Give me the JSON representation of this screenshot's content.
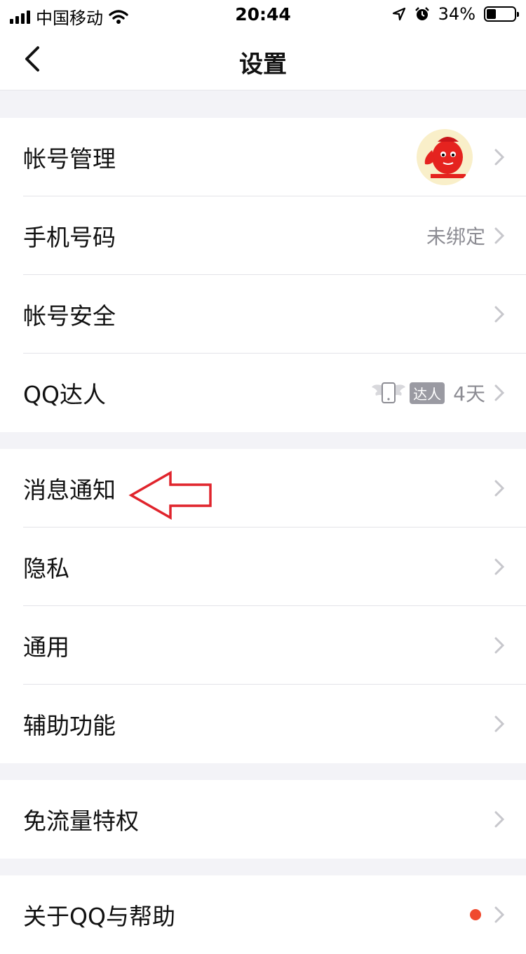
{
  "status_bar": {
    "carrier": "中国移动",
    "time": "20:44",
    "battery": "34%",
    "battery_level": 0.34
  },
  "nav": {
    "title": "设置",
    "back_icon": "chevron-left-icon"
  },
  "groups": [
    {
      "rows": [
        {
          "label": "帐号管理",
          "value": "",
          "extra": "avatar"
        },
        {
          "label": "手机号码",
          "value": "未绑定"
        },
        {
          "label": "帐号安全",
          "value": ""
        },
        {
          "label": "QQ达人",
          "badge": "达人",
          "value": "4天"
        }
      ]
    },
    {
      "rows": [
        {
          "label": "消息通知",
          "value": ""
        },
        {
          "label": "隐私",
          "value": ""
        },
        {
          "label": "通用",
          "value": ""
        },
        {
          "label": "辅助功能",
          "value": ""
        }
      ]
    },
    {
      "rows": [
        {
          "label": "免流量特权",
          "value": ""
        }
      ]
    },
    {
      "rows": [
        {
          "label": "关于QQ与帮助",
          "value": ""
        }
      ]
    }
  ],
  "colors": {
    "annotation_arrow": "#e0242c",
    "chevron": "#c7c7cc",
    "notification_dot": "#f04a2e"
  }
}
